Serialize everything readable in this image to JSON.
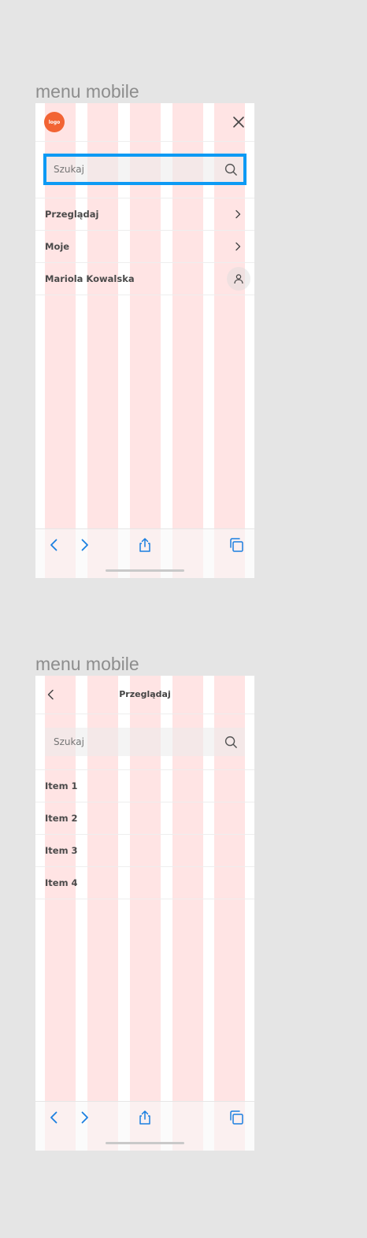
{
  "frames": [
    {
      "title": "menu mobile",
      "header": {
        "logo_text": "logo"
      },
      "search": {
        "placeholder": "Szukaj"
      },
      "menu": [
        {
          "label": "Przeglądaj"
        },
        {
          "label": "Moje"
        },
        {
          "label": "Mariola Kowalska"
        }
      ]
    },
    {
      "title": "menu mobile",
      "header": {
        "title": "Przeglądaj"
      },
      "search": {
        "placeholder": "Szukaj"
      },
      "items": [
        {
          "label": "Item 1"
        },
        {
          "label": "Item 2"
        },
        {
          "label": "Item 3"
        },
        {
          "label": "Item 4"
        }
      ]
    }
  ],
  "colors": {
    "accent": "#0d9af4",
    "logo": "#f26434",
    "grid_column": "#ff9494",
    "browser_icons": "#1a7fe0"
  }
}
